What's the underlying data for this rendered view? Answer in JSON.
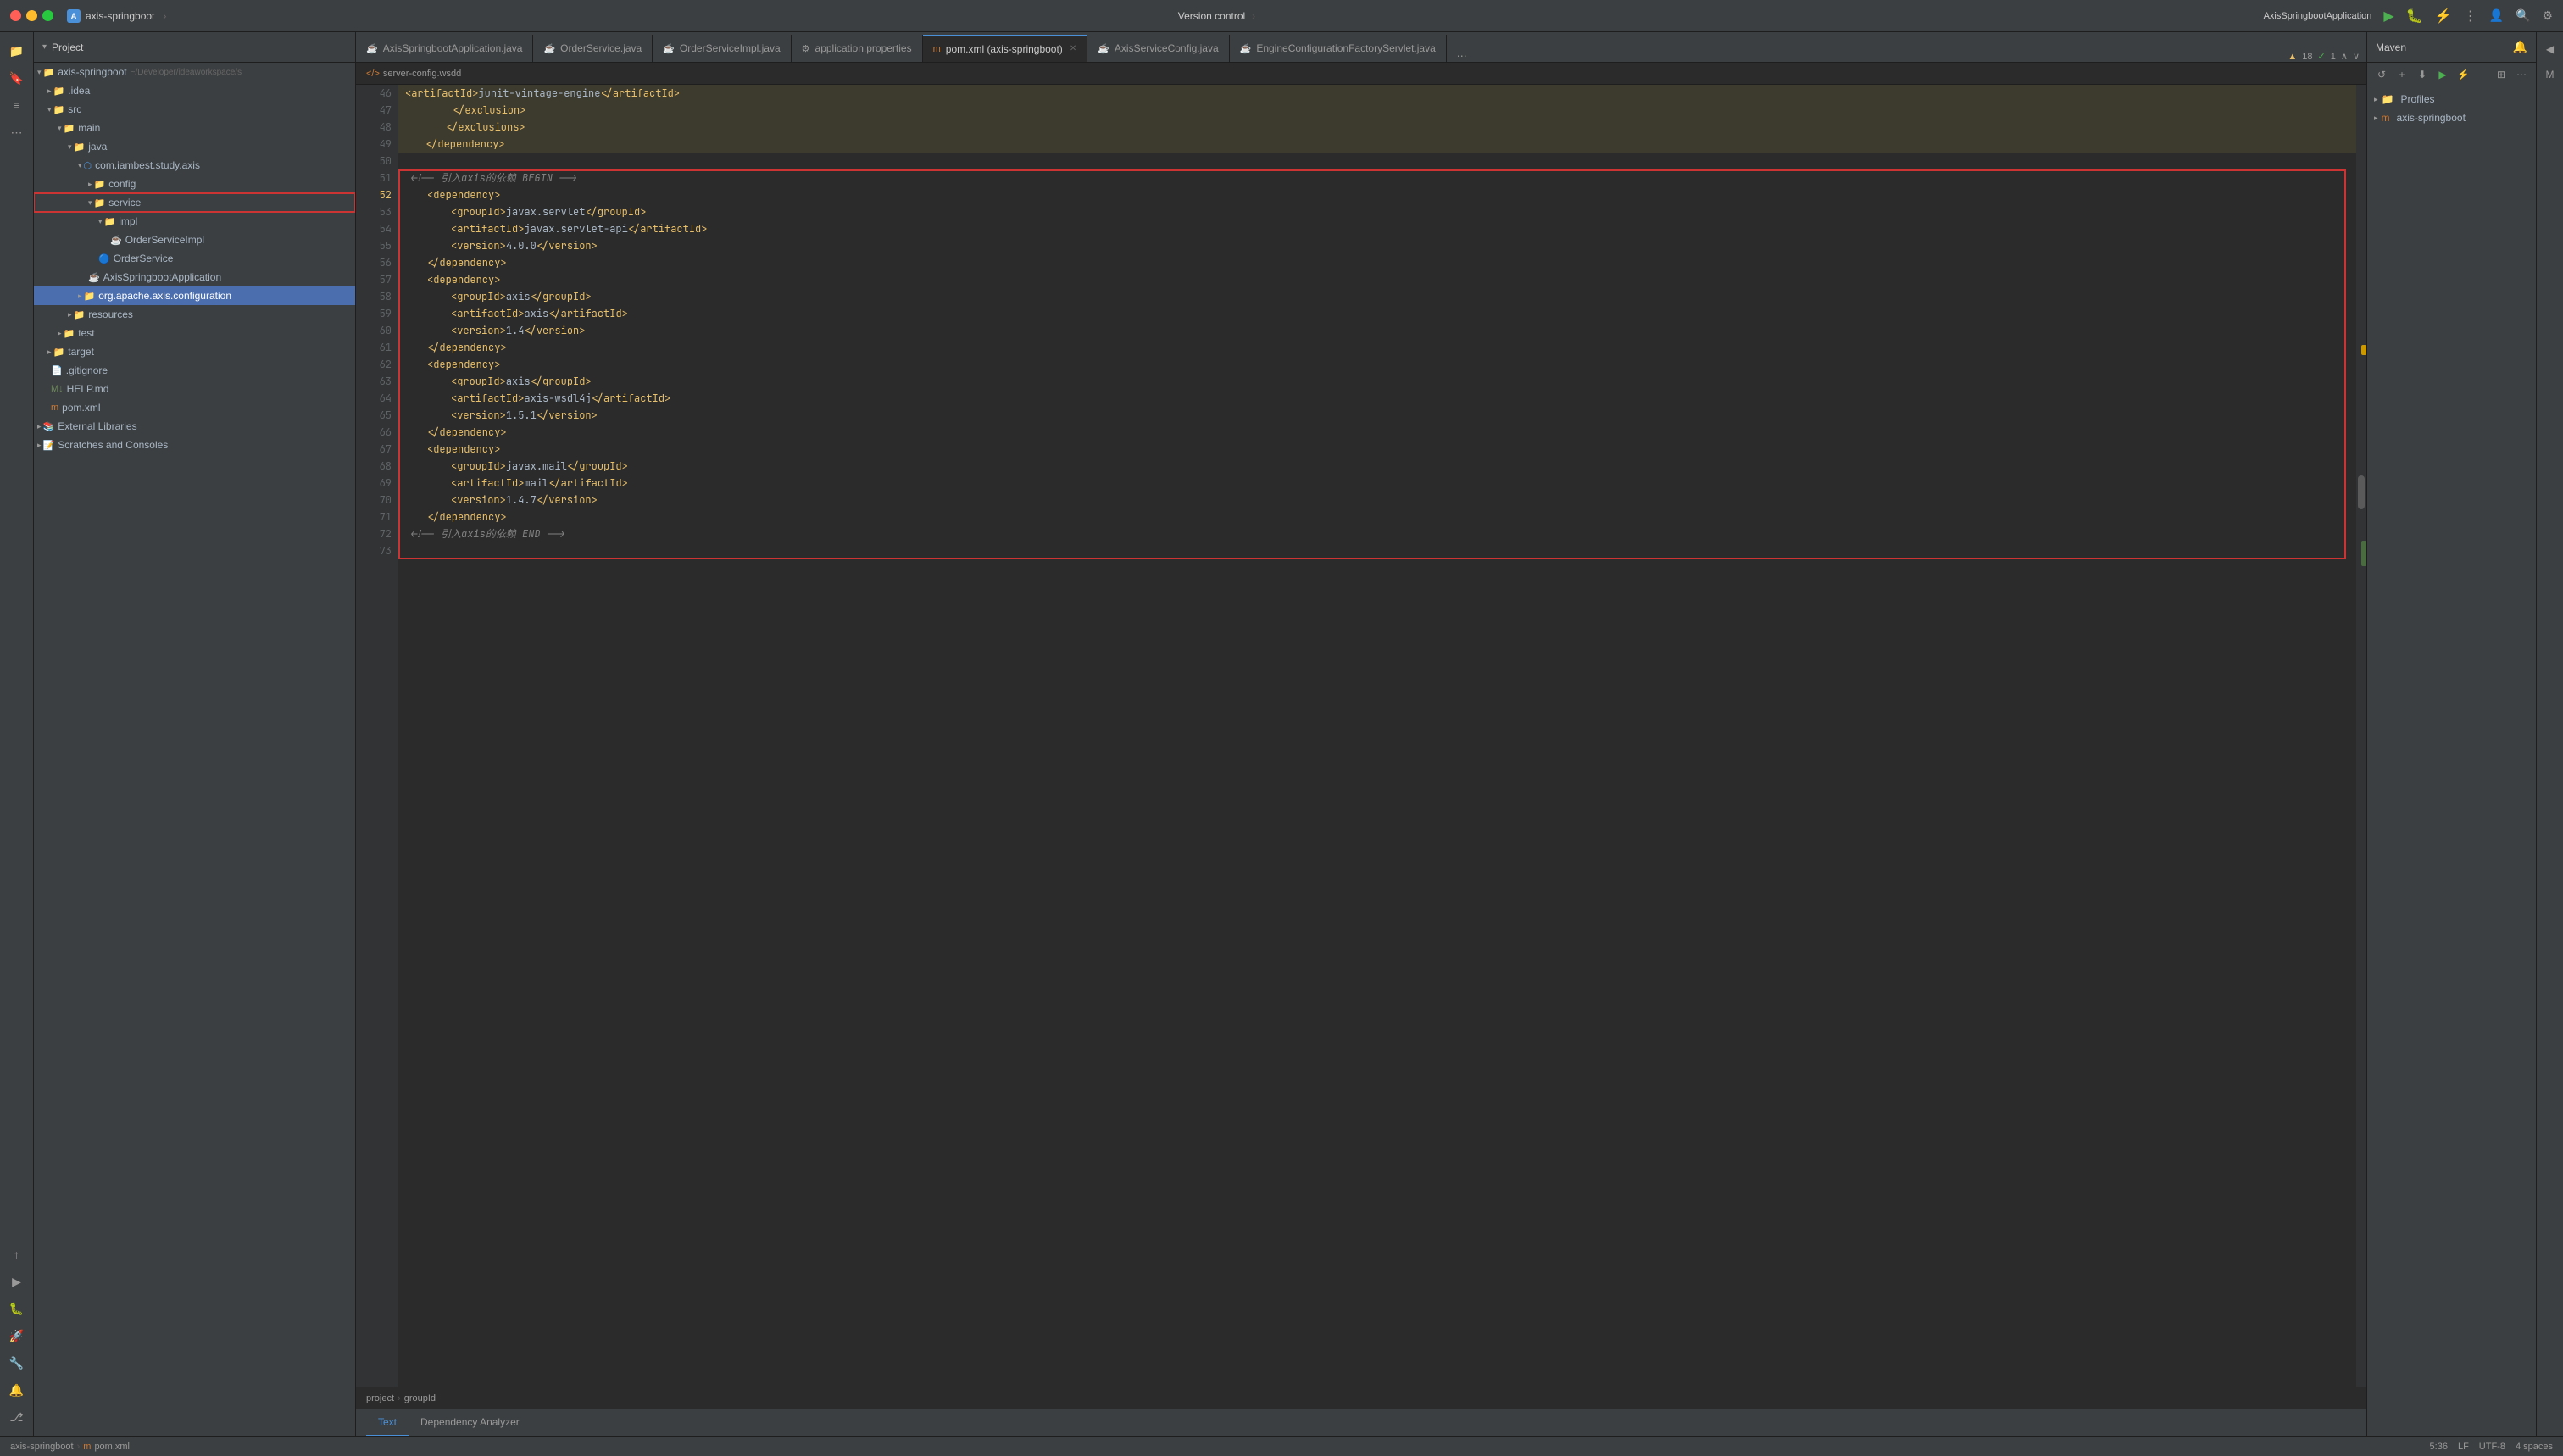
{
  "titlebar": {
    "app_name": "axis-springboot",
    "app_icon": "A",
    "version_control": "Version control",
    "run_app": "AxisSpringbootApplication",
    "actions": [
      "run",
      "debug",
      "profile",
      "more"
    ]
  },
  "project": {
    "title": "Project",
    "tree": [
      {
        "id": "axis-springboot",
        "label": "axis-springboot",
        "type": "root",
        "path": "~/Developer/ideaworkspace/s",
        "indent": 0,
        "expanded": true
      },
      {
        "id": "idea",
        "label": ".idea",
        "type": "folder",
        "indent": 1,
        "expanded": false
      },
      {
        "id": "src",
        "label": "src",
        "type": "folder",
        "indent": 1,
        "expanded": true
      },
      {
        "id": "main",
        "label": "main",
        "type": "folder",
        "indent": 2,
        "expanded": true
      },
      {
        "id": "java",
        "label": "java",
        "type": "folder",
        "indent": 3,
        "expanded": true
      },
      {
        "id": "com-iambest-study-axis",
        "label": "com.iambest.study.axis",
        "type": "package",
        "indent": 4,
        "expanded": true
      },
      {
        "id": "config",
        "label": "config",
        "type": "folder",
        "indent": 5,
        "expanded": false
      },
      {
        "id": "service",
        "label": "service",
        "type": "folder",
        "indent": 5,
        "expanded": true,
        "highlighted": true
      },
      {
        "id": "impl",
        "label": "impl",
        "type": "folder",
        "indent": 6,
        "expanded": true
      },
      {
        "id": "OrderServiceImpl",
        "label": "OrderServiceImpl",
        "type": "java",
        "indent": 7
      },
      {
        "id": "OrderService",
        "label": "OrderService",
        "type": "java-interface",
        "indent": 6
      },
      {
        "id": "AxisSpringbootApplication",
        "label": "AxisSpringbootApplication",
        "type": "java",
        "indent": 5
      },
      {
        "id": "org-apache-axis-configuration",
        "label": "org.apache.axis.configuration",
        "type": "folder",
        "indent": 4,
        "expanded": false,
        "selected": true
      },
      {
        "id": "resources",
        "label": "resources",
        "type": "folder",
        "indent": 3,
        "expanded": false
      },
      {
        "id": "test",
        "label": "test",
        "type": "folder",
        "indent": 2,
        "expanded": false
      },
      {
        "id": "target",
        "label": "target",
        "type": "folder",
        "indent": 1,
        "expanded": false
      },
      {
        "id": "gitignore",
        "label": ".gitignore",
        "type": "git",
        "indent": 1
      },
      {
        "id": "HELP-md",
        "label": "HELP.md",
        "type": "md",
        "indent": 1
      },
      {
        "id": "pom-xml",
        "label": "pom.xml",
        "type": "xml",
        "indent": 1
      },
      {
        "id": "external-libraries",
        "label": "External Libraries",
        "type": "folder",
        "indent": 0,
        "expanded": false
      },
      {
        "id": "scratches",
        "label": "Scratches and Consoles",
        "type": "folder",
        "indent": 0,
        "expanded": false
      }
    ]
  },
  "tabs": [
    {
      "id": "AxisSpringbootApplication",
      "label": "AxisSpringbootApplication.java",
      "icon": "java",
      "active": false,
      "modified": false
    },
    {
      "id": "OrderService",
      "label": "OrderService.java",
      "icon": "java",
      "active": false,
      "modified": false
    },
    {
      "id": "OrderServiceImpl",
      "label": "OrderServiceImpl.java",
      "icon": "java",
      "active": false,
      "modified": false
    },
    {
      "id": "application-properties",
      "label": "application.properties",
      "icon": "props",
      "active": false,
      "modified": false
    },
    {
      "id": "pom-xml",
      "label": "pom.xml (axis-springboot)",
      "icon": "xml",
      "active": true,
      "modified": false
    },
    {
      "id": "AxisServiceConfig",
      "label": "AxisServiceConfig.java",
      "icon": "java",
      "active": false,
      "modified": false
    },
    {
      "id": "EngineConfigurationFactoryServlet",
      "label": "EngineConfigurationFactoryServlet.java",
      "icon": "java",
      "active": false,
      "modified": false
    }
  ],
  "breadcrumb": {
    "items": [
      "</> server-config.wsdd"
    ]
  },
  "editor": {
    "lines": [
      {
        "num": 46,
        "content": "        <artifactId>junit-vintage-engine</artifactId>",
        "bg": "yellow"
      },
      {
        "num": 47,
        "content": "        </exclusion>",
        "bg": "yellow"
      },
      {
        "num": 48,
        "content": "        </exclusions>",
        "bg": "yellow"
      },
      {
        "num": 49,
        "content": "    </dependency>",
        "bg": "yellow"
      },
      {
        "num": 50,
        "content": ""
      },
      {
        "num": 51,
        "content": "    <!-- 引入axis的依赖 BEGIN -->",
        "bg": "box-start"
      },
      {
        "num": 52,
        "content": "    <dependency>",
        "bg": "box"
      },
      {
        "num": 53,
        "content": "        <groupId>javax.servlet</groupId>",
        "bg": "box"
      },
      {
        "num": 54,
        "content": "        <artifactId>javax.servlet-api</artifactId>",
        "bg": "box"
      },
      {
        "num": 55,
        "content": "        <version>4.0.0</version>",
        "bg": "box"
      },
      {
        "num": 56,
        "content": "    </dependency>",
        "bg": "box"
      },
      {
        "num": 57,
        "content": "    <dependency>",
        "bg": "box"
      },
      {
        "num": 58,
        "content": "        <groupId>axis</groupId>",
        "bg": "box"
      },
      {
        "num": 59,
        "content": "        <artifactId>axis</artifactId>",
        "bg": "box"
      },
      {
        "num": 60,
        "content": "        <version>1.4</version>",
        "bg": "box"
      },
      {
        "num": 61,
        "content": "    </dependency>",
        "bg": "box"
      },
      {
        "num": 62,
        "content": "    <dependency>",
        "bg": "box"
      },
      {
        "num": 63,
        "content": "        <groupId>axis</groupId>",
        "bg": "box"
      },
      {
        "num": 64,
        "content": "        <artifactId>axis-wsdl4j</artifactId>",
        "bg": "box"
      },
      {
        "num": 65,
        "content": "        <version>1.5.1</version>",
        "bg": "box"
      },
      {
        "num": 66,
        "content": "    </dependency>",
        "bg": "box"
      },
      {
        "num": 67,
        "content": "    <dependency>",
        "bg": "box"
      },
      {
        "num": 68,
        "content": "        <groupId>javax.mail</groupId>",
        "bg": "box"
      },
      {
        "num": 69,
        "content": "        <artifactId>mail</artifactId>",
        "bg": "box"
      },
      {
        "num": 70,
        "content": "        <version>1.4.7</version>",
        "bg": "box"
      },
      {
        "num": 71,
        "content": "    </dependency>",
        "bg": "box"
      },
      {
        "num": 72,
        "content": "    <!-- 引入axis的依赖 END -->",
        "bg": "box-end"
      },
      {
        "num": 73,
        "content": ""
      }
    ],
    "warning_badge": "▲ 18 ✓ 1",
    "box_start_line": 51,
    "box_end_line": 72
  },
  "breadcrumb_bottom": {
    "items": [
      "project",
      "groupId"
    ]
  },
  "bottom_tabs": [
    {
      "id": "text",
      "label": "Text",
      "active": true
    },
    {
      "id": "dependency-analyzer",
      "label": "Dependency Analyzer",
      "active": false
    }
  ],
  "status_bar": {
    "position": "5:36",
    "line_ending": "LF",
    "encoding": "UTF-8",
    "indent": "4 spaces",
    "project_path": "axis-springboot",
    "file": "pom.xml"
  },
  "maven": {
    "title": "Maven",
    "items": [
      {
        "id": "profiles",
        "label": "Profiles",
        "type": "folder",
        "indent": 0,
        "expanded": false
      },
      {
        "id": "axis-springboot-maven",
        "label": "axis-springboot",
        "type": "maven",
        "indent": 0,
        "expanded": false
      }
    ]
  }
}
